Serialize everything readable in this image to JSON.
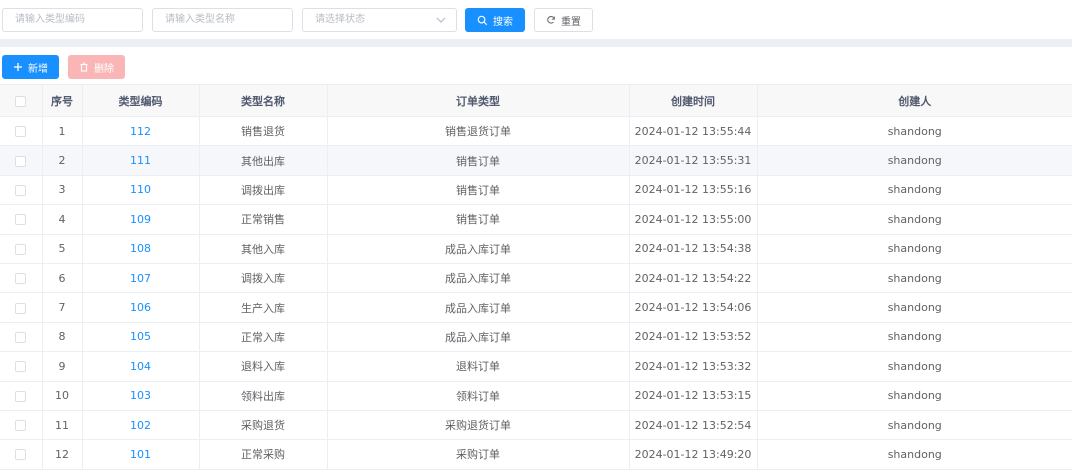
{
  "filters": {
    "type_code_placeholder": "请输入类型编码",
    "type_name_placeholder": "请输入类型名称",
    "status_placeholder": "请选择状态",
    "search_label": "搜索",
    "reset_label": "重置"
  },
  "toolbar": {
    "add_label": "新增",
    "delete_label": "删除"
  },
  "table": {
    "columns": [
      "序号",
      "类型编码",
      "类型名称",
      "订单类型",
      "创建时间",
      "创建人"
    ],
    "rows": [
      {
        "index": "1",
        "code": "112",
        "name": "销售退货",
        "order_type": "销售退货订单",
        "created_at": "2024-01-12 13:55:44",
        "creator": "shandong"
      },
      {
        "index": "2",
        "code": "111",
        "name": "其他出库",
        "order_type": "销售订单",
        "created_at": "2024-01-12 13:55:31",
        "creator": "shandong"
      },
      {
        "index": "3",
        "code": "110",
        "name": "调拨出库",
        "order_type": "销售订单",
        "created_at": "2024-01-12 13:55:16",
        "creator": "shandong"
      },
      {
        "index": "4",
        "code": "109",
        "name": "正常销售",
        "order_type": "销售订单",
        "created_at": "2024-01-12 13:55:00",
        "creator": "shandong"
      },
      {
        "index": "5",
        "code": "108",
        "name": "其他入库",
        "order_type": "成品入库订单",
        "created_at": "2024-01-12 13:54:38",
        "creator": "shandong"
      },
      {
        "index": "6",
        "code": "107",
        "name": "调拨入库",
        "order_type": "成品入库订单",
        "created_at": "2024-01-12 13:54:22",
        "creator": "shandong"
      },
      {
        "index": "7",
        "code": "106",
        "name": "生产入库",
        "order_type": "成品入库订单",
        "created_at": "2024-01-12 13:54:06",
        "creator": "shandong"
      },
      {
        "index": "8",
        "code": "105",
        "name": "正常入库",
        "order_type": "成品入库订单",
        "created_at": "2024-01-12 13:53:52",
        "creator": "shandong"
      },
      {
        "index": "9",
        "code": "104",
        "name": "退料入库",
        "order_type": "退料订单",
        "created_at": "2024-01-12 13:53:32",
        "creator": "shandong"
      },
      {
        "index": "10",
        "code": "103",
        "name": "领料出库",
        "order_type": "领料订单",
        "created_at": "2024-01-12 13:53:15",
        "creator": "shandong"
      },
      {
        "index": "11",
        "code": "102",
        "name": "采购退货",
        "order_type": "采购退货订单",
        "created_at": "2024-01-12 13:52:54",
        "creator": "shandong"
      },
      {
        "index": "12",
        "code": "101",
        "name": "正常采购",
        "order_type": "采购订单",
        "created_at": "2024-01-12 13:49:20",
        "creator": "shandong"
      }
    ]
  },
  "colors": {
    "primary": "#1890ff",
    "danger_disabled": "#fab6b6",
    "header_bg": "#f8f8f9",
    "row_hover_bg": "#f5f7fa"
  }
}
